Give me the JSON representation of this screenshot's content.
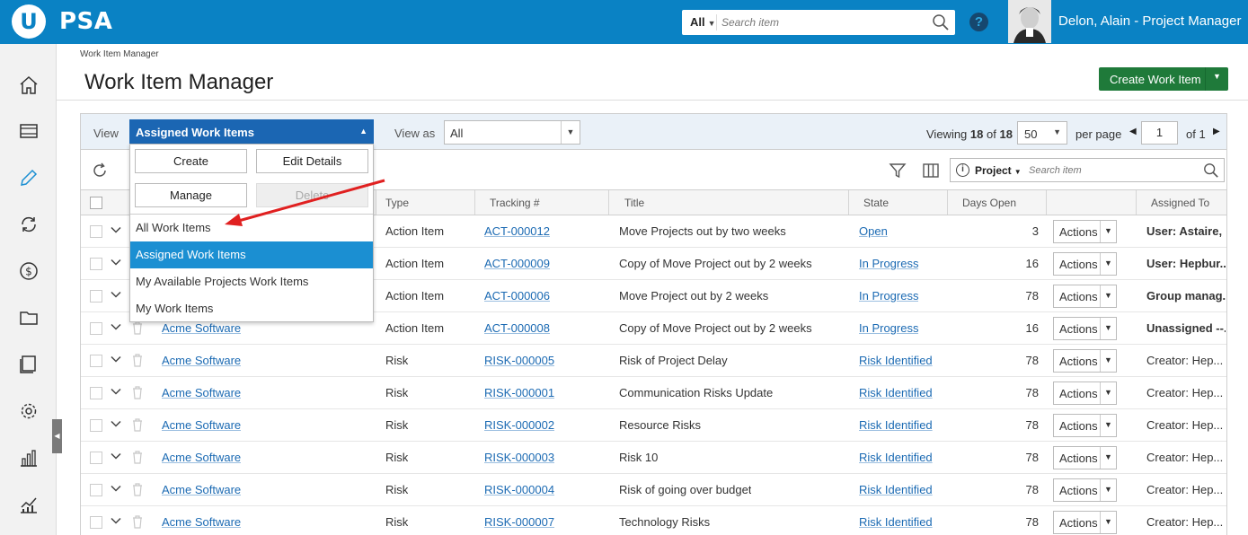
{
  "app": {
    "logo_letter": "U",
    "name": "PSA",
    "search_scope": "All",
    "search_placeholder": "Search item",
    "help": "?",
    "user_name": "Delon, Alain - Project Manager"
  },
  "sidebar": {
    "items": [
      "home-icon",
      "inbox-icon",
      "pencil-icon",
      "sync-icon",
      "dollar-icon",
      "folder-icon",
      "book-icon",
      "gear-icon",
      "bar-chart-icon",
      "trend-chart-icon"
    ]
  },
  "page": {
    "breadcrumb": "Work Item Manager",
    "title": "Work Item Manager",
    "create_button": "Create Work Item"
  },
  "viewbar": {
    "view_label": "View",
    "view_selected": "Assigned Work Items",
    "viewas_label": "View as",
    "viewas_value": "All",
    "viewing_prefix": "Viewing",
    "viewing_shown": "18",
    "viewing_of": "of",
    "viewing_total": "18",
    "per_page_value": "50",
    "per_page_label": "per page",
    "page_number": "1",
    "page_of": "of 1"
  },
  "view_menu": {
    "buttons": {
      "create": "Create",
      "edit": "Edit Details",
      "manage": "Manage",
      "delete": "Delete"
    },
    "items": [
      "All Work Items",
      "Assigned Work Items",
      "My Available Projects Work Items",
      "My Work Items"
    ],
    "selected_index": 1
  },
  "toolbar": {
    "grid_search_scope": "Project",
    "grid_search_placeholder": "Search item"
  },
  "table": {
    "headers": {
      "type": "Type",
      "tracking": "Tracking #",
      "title": "Title",
      "state": "State",
      "days": "Days Open",
      "assigned": "Assigned To"
    },
    "actions_label": "Actions",
    "rows": [
      {
        "project": "",
        "type": "Action Item",
        "tracking": "ACT-000012",
        "title": "Move Projects out by two weeks",
        "state": "Open",
        "days": "3",
        "assigned": "User: Astaire, ..."
      },
      {
        "project": "",
        "type": "Action Item",
        "tracking": "ACT-000009",
        "title": "Copy of Move Project out by 2 weeks",
        "state": "In Progress",
        "days": "16",
        "assigned": "User: Hepbur..."
      },
      {
        "project": "",
        "type": "Action Item",
        "tracking": "ACT-000006",
        "title": "Move Project out by 2 weeks",
        "state": "In Progress",
        "days": "78",
        "assigned": "Group manag..."
      },
      {
        "project": "Acme Software",
        "type": "Action Item",
        "tracking": "ACT-000008",
        "title": "Copy of Move Project out by 2 weeks",
        "state": "In Progress",
        "days": "16",
        "assigned": "Unassigned --..."
      },
      {
        "project": "Acme Software",
        "type": "Risk",
        "tracking": "RISK-000005",
        "title": "Risk of Project Delay",
        "state": "Risk Identified",
        "days": "78",
        "assigned": "Creator: Hep..."
      },
      {
        "project": "Acme Software",
        "type": "Risk",
        "tracking": "RISK-000001",
        "title": "Communication Risks Update",
        "state": "Risk Identified",
        "days": "78",
        "assigned": "Creator: Hep..."
      },
      {
        "project": "Acme Software",
        "type": "Risk",
        "tracking": "RISK-000002",
        "title": "Resource Risks",
        "state": "Risk Identified",
        "days": "78",
        "assigned": "Creator: Hep..."
      },
      {
        "project": "Acme Software",
        "type": "Risk",
        "tracking": "RISK-000003",
        "title": "Risk 10",
        "state": "Risk Identified",
        "days": "78",
        "assigned": "Creator: Hep..."
      },
      {
        "project": "Acme Software",
        "type": "Risk",
        "tracking": "RISK-000004",
        "title": "Risk of going over budget",
        "state": "Risk Identified",
        "days": "78",
        "assigned": "Creator: Hep..."
      },
      {
        "project": "Acme Software",
        "type": "Risk",
        "tracking": "RISK-000007",
        "title": "Technology Risks",
        "state": "Risk Identified",
        "days": "78",
        "assigned": "Creator: Hep..."
      }
    ]
  },
  "colors": {
    "topbar": "#0a82c4",
    "create_button": "#1f7a3a",
    "view_selected": "#1b66b3",
    "menu_selected": "#1b8fd2",
    "link": "#1b6ab3",
    "annotation_arrow": "#e02020"
  }
}
